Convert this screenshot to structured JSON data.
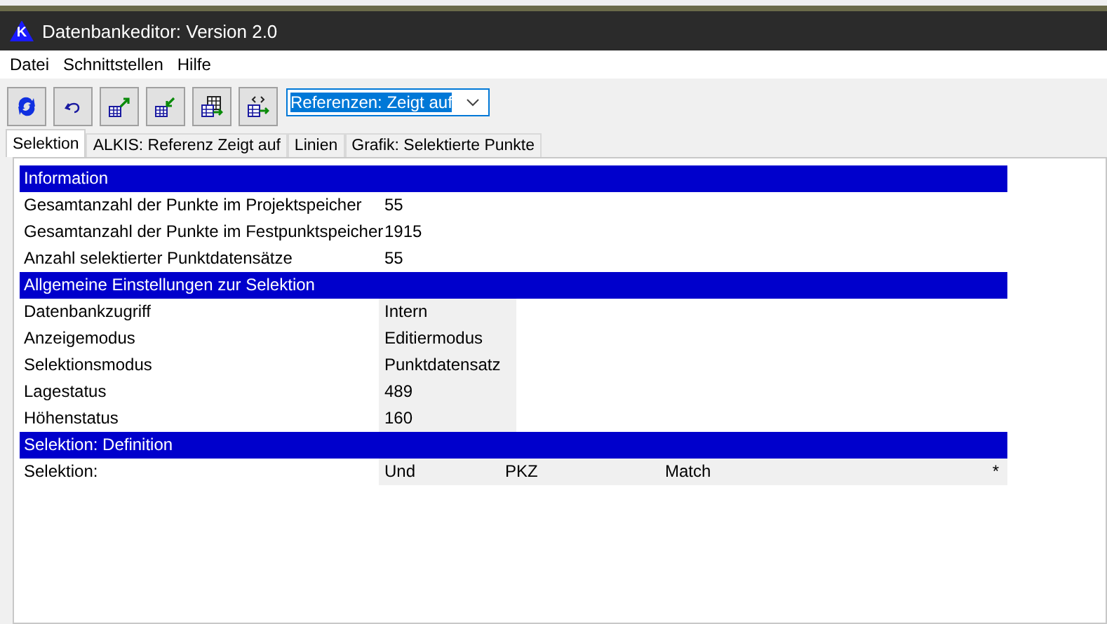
{
  "window": {
    "logo": "K",
    "title": "Datenbankeditor: Version 2.0"
  },
  "menu": [
    "Datei",
    "Schnittstellen",
    "Hilfe"
  ],
  "toolbar": {
    "buttons": [
      {
        "kind": "refresh"
      },
      {
        "kind": "undo"
      },
      {
        "kind": "export"
      },
      {
        "kind": "import"
      },
      {
        "kind": "table"
      },
      {
        "kind": "link"
      }
    ],
    "dropdown": {
      "value": "Referenzen: Zeigt auf"
    }
  },
  "tabs": [
    {
      "label": "Selektion",
      "selected": true
    },
    {
      "label": "ALKIS: Referenz Zeigt auf",
      "selected": false
    },
    {
      "label": "Linien",
      "selected": false
    },
    {
      "label": "Grafik: Selektierte Punkte",
      "selected": false
    }
  ],
  "sections": [
    {
      "title": "Information",
      "rows": [
        {
          "kind": "info",
          "label": "Gesamtanzahl der Punkte im Projektspeicher",
          "values": [
            "55"
          ]
        },
        {
          "kind": "info",
          "label": "Gesamtanzahl der Punkte im Festpunktspeicher",
          "values": [
            "1915"
          ]
        },
        {
          "kind": "info",
          "label": "Anzahl selektierter Punktdatensätze",
          "values": [
            "55"
          ]
        }
      ]
    },
    {
      "title": "Allgemeine Einstellungen zur Selektion",
      "rows": [
        {
          "kind": "setting",
          "label": "Datenbankzugriff",
          "values": [
            "Intern"
          ]
        },
        {
          "kind": "setting",
          "label": "Anzeigemodus",
          "values": [
            "Editiermodus"
          ]
        },
        {
          "kind": "setting",
          "label": "Selektionsmodus",
          "values": [
            "Punktdatensatz"
          ]
        },
        {
          "kind": "setting",
          "label": "Lagestatus",
          "values": [
            "489"
          ]
        },
        {
          "kind": "setting",
          "label": "Höhenstatus",
          "values": [
            "160"
          ]
        }
      ]
    },
    {
      "title": "Selektion: Definition",
      "rows": [
        {
          "kind": "definition",
          "label": "Selektion:",
          "values": [
            "Und",
            "PKZ",
            "Match",
            "*"
          ]
        }
      ]
    }
  ]
}
